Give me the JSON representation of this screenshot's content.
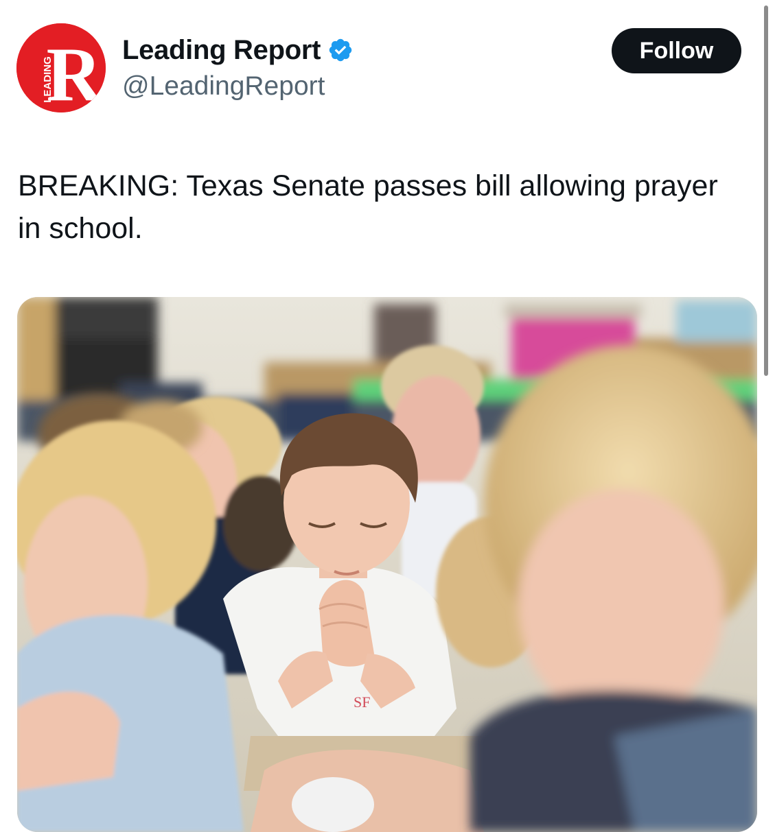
{
  "author": {
    "display_name": "Leading Report",
    "handle": "@LeadingReport",
    "avatar_text": "R",
    "avatar_side_text": "LEADING",
    "verified": true
  },
  "actions": {
    "follow_label": "Follow"
  },
  "tweet": {
    "text": "BREAKING: Texas Senate passes bill allowing prayer in school."
  },
  "media": {
    "shirt_text": "SF"
  },
  "colors": {
    "brand_red": "#e31e24",
    "verified_blue": "#1d9bf0",
    "follow_bg": "#0f1419",
    "handle_gray": "#536471"
  },
  "icons": {
    "verified": "verified-badge-icon"
  }
}
